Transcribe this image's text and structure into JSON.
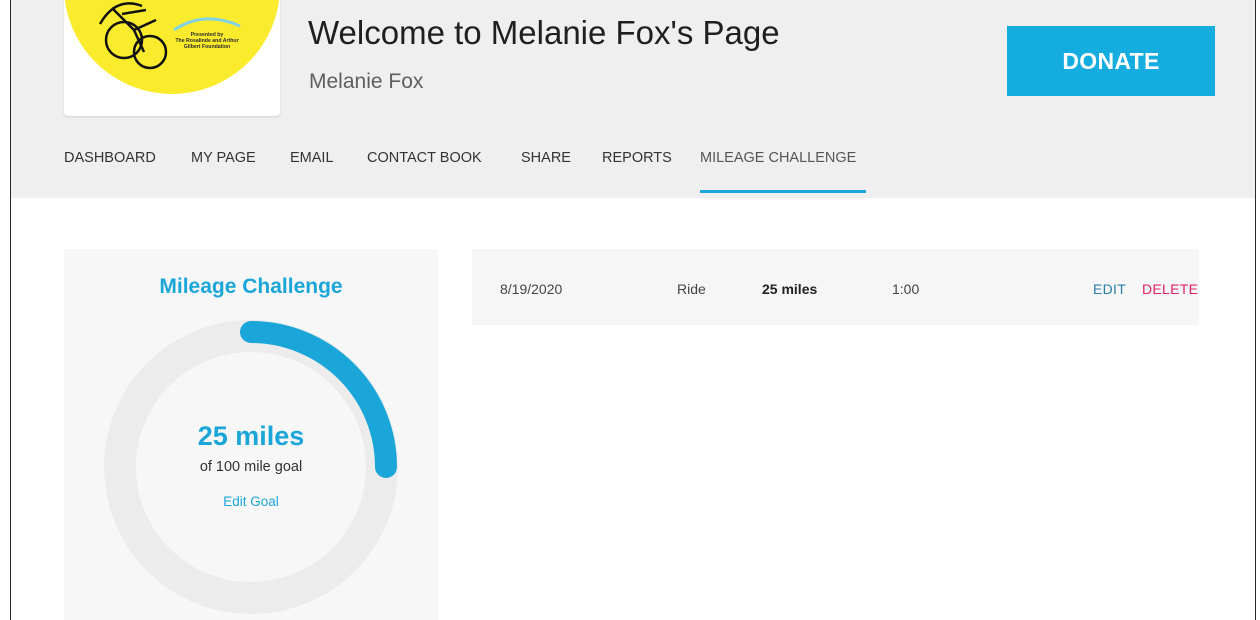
{
  "logo": {
    "text_line1": "Presented by",
    "text_line2": "The Rosalinde and Arthur",
    "text_line3": "Gilbert Foundation",
    "bg_color": "#fbeb2d"
  },
  "header": {
    "title": "Welcome to Melanie Fox's Page",
    "subtitle": "Melanie Fox",
    "donate_label": "DONATE"
  },
  "nav": {
    "items": [
      {
        "label": "DASHBOARD"
      },
      {
        "label": "MY PAGE"
      },
      {
        "label": "EMAIL"
      },
      {
        "label": "CONTACT BOOK"
      },
      {
        "label": "SHARE"
      },
      {
        "label": "REPORTS"
      },
      {
        "label": "MILEAGE CHALLENGE",
        "active": true
      }
    ]
  },
  "challenge": {
    "title": "Mileage Challenge",
    "progress_label": "25 miles",
    "goal_label": "of 100 mile goal",
    "edit_goal_label": "Edit Goal",
    "miles": 25,
    "goal": 100,
    "accent_color": "#1aa6d8",
    "track_color": "#ececec"
  },
  "log": {
    "rows": [
      {
        "date": "8/19/2020",
        "activity": "Ride",
        "distance": "25 miles",
        "duration": "1:00",
        "edit_label": "EDIT",
        "delete_label": "DELETE"
      }
    ]
  }
}
